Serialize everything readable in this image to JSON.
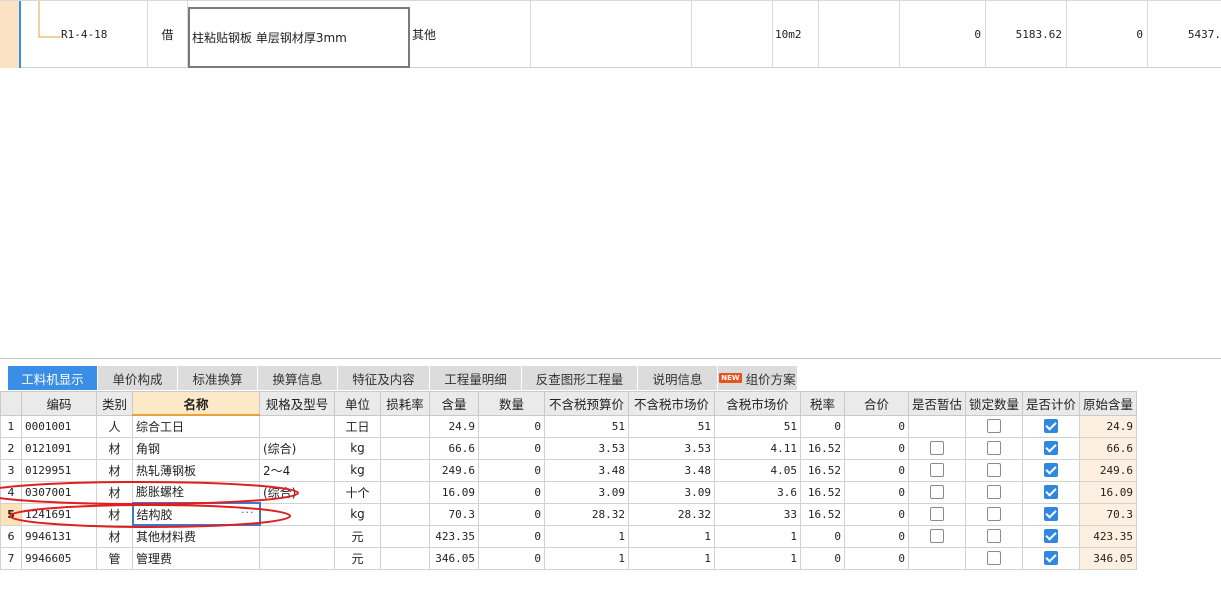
{
  "top_row": {
    "code": "R1-4-18",
    "type": "借",
    "name": "柱粘贴钢板 单层钢材厚3mm",
    "category": "其他",
    "unit": "10m2",
    "v1": "0",
    "v2": "5183.62",
    "v3": "0",
    "v4": "5437."
  },
  "tabs": [
    {
      "label": "工料机显示",
      "active": true
    },
    {
      "label": "单价构成"
    },
    {
      "label": "标准换算"
    },
    {
      "label": "换算信息"
    },
    {
      "label": "特征及内容"
    },
    {
      "label": "工程量明细"
    },
    {
      "label": "反查图形工程量"
    },
    {
      "label": "说明信息"
    },
    {
      "label": "组价方案",
      "badge": "NEW"
    }
  ],
  "table": {
    "headers": [
      "",
      "编码",
      "类别",
      "名称",
      "规格及型号",
      "单位",
      "损耗率",
      "含量",
      "数量",
      "不含税预算价",
      "不含税市场价",
      "含税市场价",
      "税率",
      "合价",
      "是否暂估",
      "锁定数量",
      "是否计价",
      "原始含量"
    ],
    "rows": [
      {
        "no": "1",
        "code": "0001001",
        "cat": "人",
        "name": "综合工日",
        "spec": "",
        "unit": "工日",
        "loss": "",
        "qty": "24.9",
        "amount": "0",
        "pre": "51",
        "mkt": "51",
        "tax_mkt": "51",
        "rate": "0",
        "total": "0",
        "est": null,
        "lock": false,
        "priced": true,
        "orig": "24.9"
      },
      {
        "no": "2",
        "code": "0121091",
        "cat": "材",
        "name": "角钢",
        "spec": "(综合)",
        "unit": "kg",
        "loss": "",
        "qty": "66.6",
        "amount": "0",
        "pre": "3.53",
        "mkt": "3.53",
        "tax_mkt": "4.11",
        "rate": "16.52",
        "total": "0",
        "est": false,
        "lock": false,
        "priced": true,
        "orig": "66.6"
      },
      {
        "no": "3",
        "code": "0129951",
        "cat": "材",
        "name": "热轧薄钢板",
        "spec": "2～4",
        "unit": "kg",
        "loss": "",
        "qty": "249.6",
        "amount": "0",
        "pre": "3.48",
        "mkt": "3.48",
        "tax_mkt": "4.05",
        "rate": "16.52",
        "total": "0",
        "est": false,
        "lock": false,
        "priced": true,
        "orig": "249.6"
      },
      {
        "no": "4",
        "code": "0307001",
        "cat": "材",
        "name": "膨胀螺栓",
        "spec": "(综合)",
        "unit": "十个",
        "loss": "",
        "qty": "16.09",
        "amount": "0",
        "pre": "3.09",
        "mkt": "3.09",
        "tax_mkt": "3.6",
        "rate": "16.52",
        "total": "0",
        "est": false,
        "lock": false,
        "priced": true,
        "orig": "16.09"
      },
      {
        "no": "5",
        "code": "1241691",
        "cat": "材",
        "name": "结构胶",
        "spec": "",
        "unit": "kg",
        "loss": "",
        "qty": "70.3",
        "amount": "0",
        "pre": "28.32",
        "mkt": "28.32",
        "tax_mkt": "33",
        "rate": "16.52",
        "total": "0",
        "est": false,
        "lock": false,
        "priced": true,
        "orig": "70.3"
      },
      {
        "no": "6",
        "code": "9946131",
        "cat": "材",
        "name": "其他材料费",
        "spec": "",
        "unit": "元",
        "loss": "",
        "qty": "423.35",
        "amount": "0",
        "pre": "1",
        "mkt": "1",
        "tax_mkt": "1",
        "rate": "0",
        "total": "0",
        "est": false,
        "lock": false,
        "priced": true,
        "orig": "423.35"
      },
      {
        "no": "7",
        "code": "9946605",
        "cat": "管",
        "name": "管理费",
        "spec": "",
        "unit": "元",
        "loss": "",
        "qty": "346.05",
        "amount": "0",
        "pre": "1",
        "mkt": "1",
        "tax_mkt": "1",
        "rate": "0",
        "total": "0",
        "est": null,
        "lock": false,
        "priced": true,
        "orig": "346.05"
      }
    ]
  },
  "ellipsis": "···",
  "colors": {
    "accent": "#3a8ee6",
    "annotation": "#e02020",
    "current_row": "#fde3b8"
  }
}
